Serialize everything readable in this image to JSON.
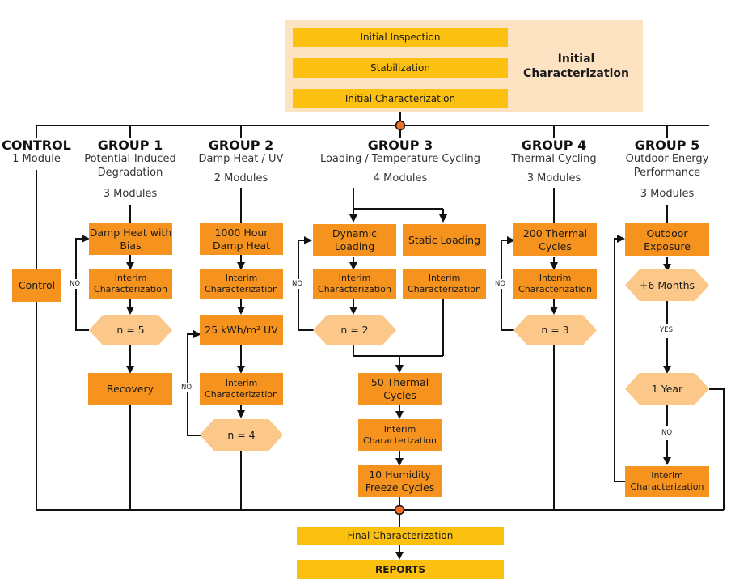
{
  "colors": {
    "initial_panel": "#fde3c2",
    "phase_box": "#fcc010",
    "step_box": "#f6931e",
    "decision_box": "#fbc88a",
    "junction_dot": "#ef6d2b",
    "line": "#111111"
  },
  "initial": {
    "panel_title": "Initial Characterization",
    "steps": [
      "Initial Inspection",
      "Stabilization",
      "Initial Characterization"
    ]
  },
  "control": {
    "title": "CONTROL",
    "modules": "1 Module",
    "step": "Control"
  },
  "group1": {
    "title": "GROUP 1",
    "subtitle": "Potential-Induced Degradation",
    "modules": "3 Modules",
    "step1": "Damp Heat with Bias",
    "step2": "Interim Characterization",
    "decision": "n = 5",
    "loop_label": "NO",
    "step3": "Recovery"
  },
  "group2": {
    "title": "GROUP 2",
    "subtitle": "Damp Heat / UV",
    "modules": "2 Modules",
    "step1": "1000 Hour Damp Heat",
    "step2": "Interim Characterization",
    "step3": "25 kWh/m² UV",
    "step4": "Interim Characterization",
    "decision": "n = 4",
    "loop_label": "NO"
  },
  "group3": {
    "title": "GROUP 3",
    "subtitle": "Loading / Temperature Cycling",
    "modules": "4 Modules",
    "branch_a_step1": "Dynamic Loading",
    "branch_a_step2": "Interim Characterization",
    "branch_a_decision": "n = 2",
    "loop_label": "NO",
    "branch_b_step1": "Static Loading",
    "branch_b_step2": "Interim Characterization",
    "merge_step1": "50 Thermal Cycles",
    "merge_step2": "Interim Characterization",
    "merge_step3": "10 Humidity Freeze Cycles"
  },
  "group4": {
    "title": "GROUP 4",
    "subtitle": "Thermal Cycling",
    "modules": "3 Modules",
    "step1": "200 Thermal Cycles",
    "step2": "Interim Characterization",
    "decision": "n = 3",
    "loop_label": "NO"
  },
  "group5": {
    "title": "GROUP 5",
    "subtitle": "Outdoor Energy Performance",
    "modules": "3 Modules",
    "step1": "Outdoor Exposure",
    "decision1": "+6 Months",
    "yes_label": "YES",
    "decision2": "1 Year",
    "no_label": "NO",
    "step2": "Interim Characterization"
  },
  "final": {
    "steps": [
      "Final Characterization",
      "REPORTS"
    ]
  }
}
